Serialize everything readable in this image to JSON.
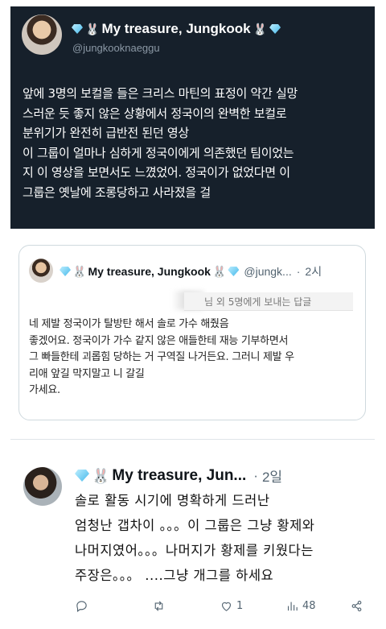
{
  "dark_post": {
    "author_name": "My treasure, Jungkook",
    "handle": "@jungkooknaeggu",
    "badge_icons": [
      "diamond-icon",
      "bunny-icon"
    ],
    "body_lines": [
      "앞에 3명의 보컬을 들은 크리스 마틴의 표정이 약간 실망",
      "스러운 듯 좋지 않은 상황에서 정국이의 완벽한 보컬로",
      "분위기가 완전히 급반전 된던 영상",
      "이 그룹이 얼마나 심하게 정국이에게 의존했던 팀이었는",
      "지 이 영상을 보면서도 느꼈었어. 정국이가 없었다면 이",
      "그룹은 옛날에 조롱당하고 사라졌을 걸"
    ],
    "background": "#16202b"
  },
  "quote_post": {
    "author_name": "My treasure, Jungkook",
    "handle": "@jungk...",
    "time": "2시",
    "reply_context": "님 외 5명에게 보내는 답글",
    "body_lines": [
      "네 제발 정국이가 탈방탄 해서 솔로 가수 해줬음",
      "좋겠어요. 정국이가 가수 같지 않은 애들한테 재능 기부하면서",
      "그 빠들한테 괴롭힘 당하는 거 구역질 나거든요. 그러니 제발 우",
      "리애 앞길 막지말고 니 갈길",
      "가세요."
    ]
  },
  "bottom_tweet": {
    "author_name": "My treasure, Jun...",
    "time": "2일",
    "body_lines": [
      "솔로 활동 시기에 명확하게 드러난",
      "엄청난 갭차이 。。。이 그룹은 그냥 황제와",
      "나머지였어。。。나머지가 황제를 키웠다는",
      "주장은。。。 ....그냥 개그를 하세요"
    ],
    "actions": {
      "reply_count": "",
      "retweet_count": "",
      "like_count": "1",
      "views_count": "48"
    }
  }
}
